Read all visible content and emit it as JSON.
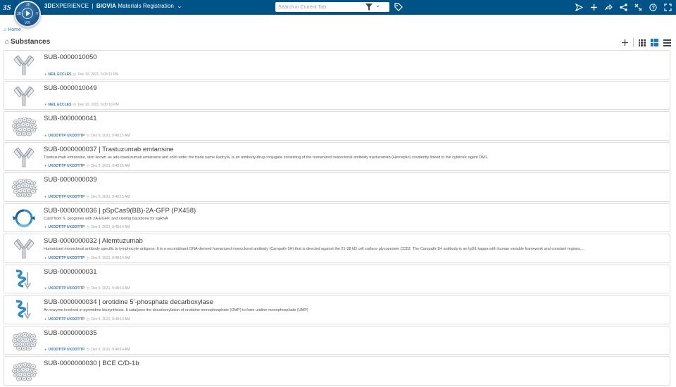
{
  "topbar": {
    "brand_prefix": "3D",
    "brand_experience": "EXPERIENCE",
    "brand_sep": "|",
    "brand_company": "BIOVIA",
    "brand_app": "Materials Registration",
    "search_placeholder": "Search in Current Tab",
    "compass_labels": {
      "top": "3D",
      "left": "3D",
      "right": "V",
      "bottom": "V.R"
    },
    "colors": {
      "bar": "#005386",
      "accent": "#3a78b5"
    },
    "icons": [
      "share-icon",
      "add-icon",
      "share-arrow-icon",
      "network-icon",
      "tools-icon",
      "help-icon",
      "fullscreen-icon"
    ]
  },
  "breadcrumb": {
    "label": "Home"
  },
  "page": {
    "title": "Substances"
  },
  "view_tools": {
    "icons": [
      "add-icon",
      "thumbnail-view-icon",
      "tile-view-icon",
      "list-view-icon"
    ]
  },
  "items": [
    {
      "title": "SUB-0000010050",
      "desc": "",
      "user": "NEIL ECCLES",
      "date": "Dec 10, 2021, 5:03:11 PM",
      "thumb": "antibody"
    },
    {
      "title": "SUB-0000010049",
      "desc": "",
      "user": "NEIL ECCLES",
      "date": "Dec 10, 2021, 5:00:16 PM",
      "thumb": "antibody"
    },
    {
      "title": "SUB-0000000041",
      "desc": "",
      "user": "UXODTITP UXODTITP",
      "date": "Dec 9, 2021, 9:48:15 AM",
      "thumb": "cells"
    },
    {
      "title": "SUB-0000000037 | Trastuzumab emtansine",
      "desc": "Trastuzumab emtansine, also known as ado-trastuzumab emtansine and sold under the trade name Kadcyla, is an antibody-drug conjugate consisting of the humanized monoclonal antibody trastuzumab (Herceptin) covalently linked to the cytotoxic agent DM1.",
      "user": "UXODTITP UXODTITP",
      "date": "Dec 9, 2021, 9:48:15 AM",
      "thumb": "antibody"
    },
    {
      "title": "SUB-0000000039",
      "desc": "",
      "user": "UXODTITP UXODTITP",
      "date": "Dec 9, 2021, 9:48:15 AM",
      "thumb": "cells"
    },
    {
      "title": "SUB-0000000036 | pSpCas9(BB)-2A-GFP (PX458)",
      "desc": "Cas9 from S. pyogenes with 2A-EGFP, and cloning backbone for sgRNA",
      "user": "UXODTITP UXODTITP",
      "date": "Dec 9, 2021, 9:48:14 AM",
      "thumb": "plasmid"
    },
    {
      "title": "SUB-0000000032 | Alemtuzumab",
      "desc": "Humanized monoclonal antibody specific to lymphocyte antigens. It is a recombinant DNA-derived humanized monoclonal antibody (Campath-1H) that is directed against the 21-28 kD cell surface glycoprotein,CD52. The Campath-1H antibody is an IgG1 kappa with human variable framework and constant regions,...",
      "user": "UXODTITP UXODTITP",
      "date": "Dec 9, 2021, 9:48:14 AM",
      "thumb": "antibody"
    },
    {
      "title": "SUB-0000000031",
      "desc": "",
      "user": "UXODTITP UXODTITP",
      "date": "Dec 9, 2021, 9:48:14 AM",
      "thumb": "protein"
    },
    {
      "title": "SUB-0000000034 | orotidine 5'-phosphate decarboxylase",
      "desc": "An enzyme involved in pyrimidine biosynthesis. It catalyzes the decarboxylation of orotidine monophosphate (OMP) to form uridine monophosphate (UMP)",
      "user": "UXODTITP UXODTITP",
      "date": "Dec 9, 2021, 9:48:14 AM",
      "thumb": "protein"
    },
    {
      "title": "SUB-0000000035",
      "desc": "",
      "user": "UXODTITP UXODTITP",
      "date": "Dec 9, 2021, 9:48:14 AM",
      "thumb": "cells"
    },
    {
      "title": "SUB-0000000030 | BCE C/D-1b",
      "desc": "",
      "user": "",
      "date": "",
      "thumb": "cells"
    }
  ]
}
